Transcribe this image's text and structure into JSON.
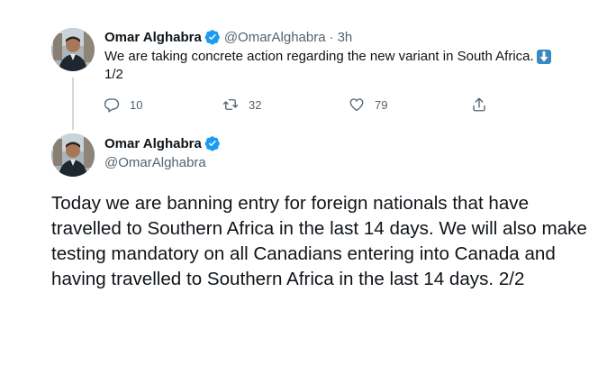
{
  "tweet1": {
    "author_name": "Omar Alghabra",
    "handle": "@OmarAlghabra",
    "separator": "·",
    "time": "3h",
    "text": "We are taking concrete action regarding the new variant in South Africa.",
    "text_suffix": "1/2",
    "arrow_icon": "down-arrow-emoji",
    "actions": {
      "reply_count": "10",
      "retweet_count": "32",
      "like_count": "79"
    }
  },
  "tweet2": {
    "author_name": "Omar Alghabra",
    "handle": "@OmarAlghabra",
    "text": "Today we are banning entry for foreign nationals that have travelled to Southern Africa in the last 14 days. We will also make testing mandatory on all Canadians entering into Canada and having travelled to Southern Africa in the last 14 days. 2/2"
  },
  "colors": {
    "verified_badge": "#1d9bf0",
    "muted_text": "#536471",
    "thread_line": "#cfd9de",
    "arrow_emoji_bg": "#3b88c3"
  }
}
